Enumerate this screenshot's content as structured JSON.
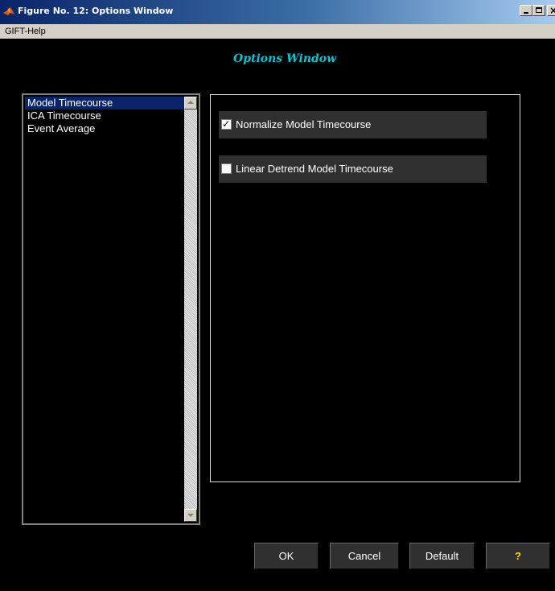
{
  "window": {
    "title": "Figure No. 12: Options Window",
    "controls": {
      "minimize_icon": "minimize-icon",
      "maximize_icon": "maximize-icon",
      "close_glyph": "×"
    }
  },
  "menubar": {
    "items": [
      {
        "label": "GIFT-Help"
      }
    ]
  },
  "heading": "Options Window",
  "listbox": {
    "items": [
      {
        "label": "Model Timecourse",
        "selected": true
      },
      {
        "label": "ICA Timecourse",
        "selected": false
      },
      {
        "label": "Event Average",
        "selected": false
      }
    ]
  },
  "options": [
    {
      "label": "Normalize Model Timecourse",
      "checked": true,
      "check_glyph": "✓"
    },
    {
      "label": "Linear Detrend Model Timecourse",
      "checked": false,
      "check_glyph": ""
    }
  ],
  "buttons": {
    "ok": "OK",
    "cancel": "Cancel",
    "default": "Default",
    "help": "?"
  },
  "colors": {
    "background": "#000000",
    "heading": "#00c8d2",
    "selection": "#0a246a",
    "help_glyph": "#ffd800"
  }
}
